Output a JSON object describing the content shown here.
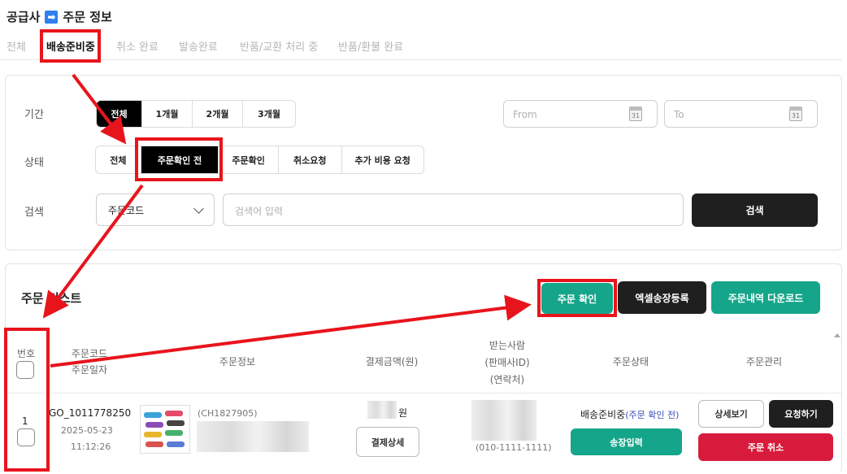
{
  "header": {
    "title_left": "공급사",
    "title_right": "주문 정보",
    "arrow_icon": "➡"
  },
  "tabs": [
    "전체",
    "배송준비중",
    "취소 완료",
    "발송완료",
    "반품/교환 처리 중",
    "반품/환불 완료"
  ],
  "filters": {
    "period_label": "기간",
    "period_options": [
      "전체",
      "1개월",
      "2개월",
      "3개월"
    ],
    "date_from_placeholder": "From",
    "date_to_placeholder": "To",
    "calendar_day": "31",
    "status_label": "상태",
    "status_options": [
      "전체",
      "주문확인 전",
      "주문확인",
      "취소요청",
      "추가 비용 요청"
    ],
    "search_label": "검색",
    "search_type": "주문코드",
    "search_placeholder": "검색어 입력",
    "search_button": "검색"
  },
  "list": {
    "title": "주문 리스트",
    "btn_confirm": "주문 확인",
    "btn_excel": "엑셀송장등록",
    "btn_download": "주문내역 다운로드",
    "headers": {
      "no": "번호",
      "code_1": "주문코드",
      "code_2": "주문일자",
      "info": "주문정보",
      "amount": "결제금액(원)",
      "recv_1": "받는사람",
      "recv_2": "(판매사ID)",
      "recv_3": "(연락처)",
      "status": "주문상태",
      "manage": "주문관리"
    },
    "row": {
      "no": "1",
      "code": "GO_1011778250",
      "date": "2025-05-23",
      "time": "11:12:26",
      "product_code": "(CH1827905)",
      "amount_unit": "원",
      "btn_payment_detail": "결제상세",
      "phone": "(010-1111-1111)",
      "status_main": "배송준비중",
      "status_sub": "(주문 확인 전)",
      "btn_invoice": "송장입력",
      "btn_detail": "상세보기",
      "btn_request": "요청하기",
      "btn_cancel": "주문 취소"
    }
  },
  "colors": {
    "accent_teal": "#15a58a",
    "danger_red": "#d81b3c",
    "highlight_red": "#e8141c",
    "dark": "#1f1f1f",
    "link_blue": "#3a4fb5"
  }
}
